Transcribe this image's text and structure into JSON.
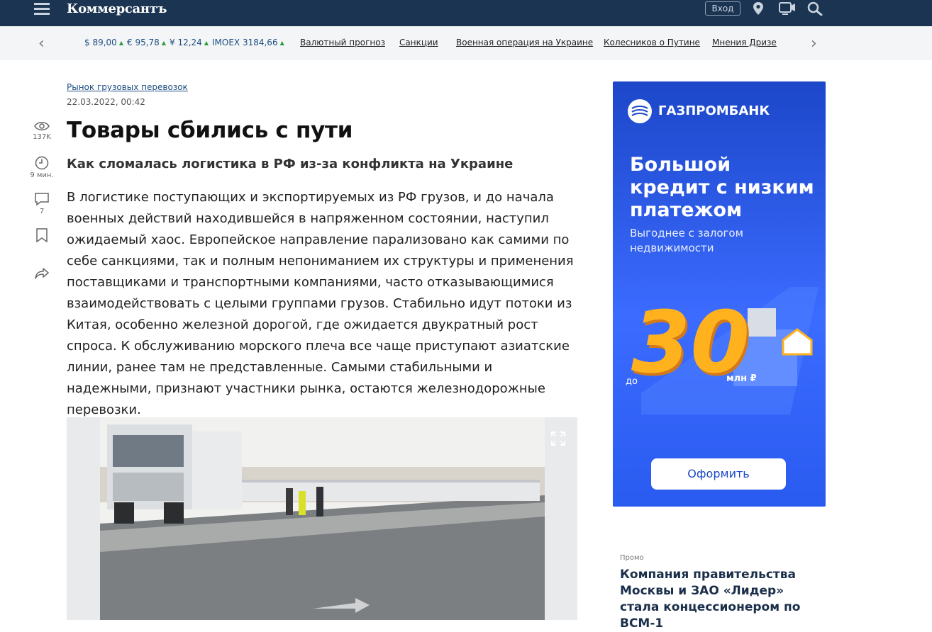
{
  "header": {
    "logo_text": "Коммерсантъ",
    "login_label": "Вход",
    "icons": [
      "menu-icon",
      "location-icon",
      "tv-icon",
      "search-icon"
    ]
  },
  "ticker": {
    "rates": [
      {
        "label": "$ 89,00",
        "trend": "up"
      },
      {
        "label": "€ 95,78",
        "trend": "up"
      },
      {
        "label": "¥ 12,24",
        "trend": "up"
      },
      {
        "label": "IMOEX 3184,66",
        "trend": "up"
      }
    ],
    "links": [
      "Валютный прогноз",
      "Санкции",
      "Военная операция на Украине",
      "Колесников о Путине",
      "Мнения Дризе"
    ]
  },
  "tools": {
    "views": "137K",
    "read_time": "9 мин.",
    "comments": "7"
  },
  "article": {
    "rubric": "Рынок грузовых перевозок",
    "date": "22.03.2022, 00:42",
    "title": "Товары сбились с пути",
    "subtitle": "Как сломалась логистика в РФ из-за конфликта на Украине",
    "lead": "В логистике поступающих и экспортируемых из РФ грузов, и до начала военных действий находившейся в напряженном состоянии, наступил ожидаемый хаос. Европейское направление парализовано как самими по себе санкциями, так и полным непониманием их структуры и применения поставщиками и транспортными компаниями, часто отказывающимися взаимодействовать с целыми группами грузов. Стабильно идут потоки из Китая, особенно железной дорогой, где ожидается двукратный рост спроса. К обслуживанию морского плеча все чаще приступают азиатские линии, ранее там не представленные. Самыми стабильными и надежными, признают участники рынка, остаются железнодорожные перевозки."
  },
  "ad": {
    "brand": "ГАЗПРОМБАНК",
    "headline": "Большой кредит с низким платежом",
    "subline": "Выгоднее с залогом недвижимости",
    "prefix": "до",
    "amount": "30",
    "unit": "млн ₽",
    "button": "Оформить",
    "colors": {
      "background": "#2a5bf0",
      "accent": "#ffb21e"
    }
  },
  "promo": {
    "label": "Промо",
    "title": "Компания правительства Москвы и ЗАО «Лидер» стала концессионером по ВСМ-1"
  }
}
